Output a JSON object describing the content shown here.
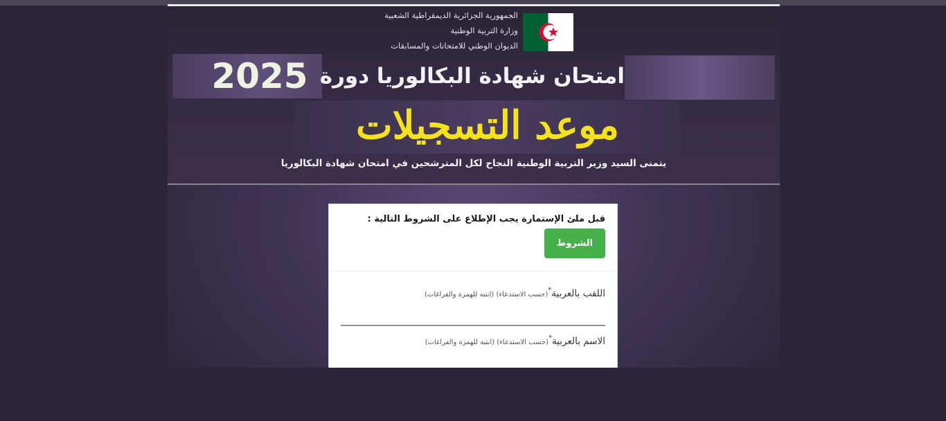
{
  "header": {
    "republic": "الجمهورية الجزائرية الديمقراطية الشعبية",
    "ministry": "وزارة التربية الوطنية",
    "office": "الديوان الوطني للامتحانات والمسابقات",
    "year": "2025",
    "exam_title": "امتحان شهادة البكالوريا دورة",
    "registration_title": "موعد التسجيلات",
    "minister_message": "يتمنى السيد وزير التربية الوطنية النجاح لكل المترشحين في امتحان شهادة البكالوريا"
  },
  "form": {
    "notice": "قبل ملئ الإستمارة يجب الإطلاع على الشروط التالية :",
    "terms_button": "الشروط",
    "fields": [
      {
        "label": "اللقب بالعربية",
        "required_mark": "*",
        "hint": "(حسب الاستدعاء) (انتبه للهمزة والفراغات)",
        "value": ""
      },
      {
        "label": "الاسم بالعربية",
        "required_mark": "*",
        "hint": "(حسب الاستدعاء) (انتبه للهمزة والفراغات)",
        "value": ""
      }
    ]
  },
  "colors": {
    "background": "#2c2539",
    "banner": "#5f4f7a",
    "registration_text": "#f4e21a",
    "terms_button": "#46b04a",
    "flag_green": "#006233",
    "flag_red": "#d21034"
  },
  "icons": {
    "flag": "algeria-flag-icon"
  }
}
